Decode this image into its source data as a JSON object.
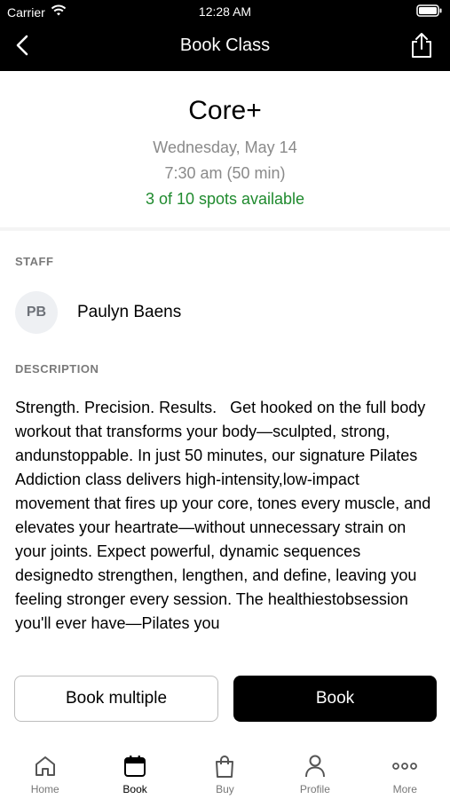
{
  "status_bar": {
    "carrier": "Carrier",
    "time": "12:28 AM"
  },
  "nav": {
    "title": "Book Class",
    "back_icon": "chevron-left-icon",
    "share_icon": "share-icon"
  },
  "class": {
    "name": "Core+",
    "date": "Wednesday, May 14",
    "time": "7:30 am (50 min)",
    "spots": "3 of 10 spots available",
    "spots_color": "#1f8a2e"
  },
  "staff": {
    "label": "STAFF",
    "initials": "PB",
    "name": "Paulyn Baens"
  },
  "description": {
    "label": "DESCRIPTION",
    "text": "Strength. Precision. Results.   Get hooked on the full body workout that transforms your body—sculpted, strong, andunstoppable. In just 50 minutes, our signature Pilates Addiction class delivers high-intensity,low-impact movement that fires up your core, tones every muscle, and elevates your heartrate—without unnecessary strain on your joints. Expect powerful, dynamic sequences designedto strengthen, lengthen, and define, leaving you feeling stronger every session. The healthiestobsession you'll ever have—Pilates you"
  },
  "actions": {
    "book_multiple": "Book multiple",
    "book": "Book"
  },
  "tabs": [
    {
      "label": "Home",
      "icon": "home-icon"
    },
    {
      "label": "Book",
      "icon": "calendar-icon",
      "active": true
    },
    {
      "label": "Buy",
      "icon": "shopping-bag-icon"
    },
    {
      "label": "Profile",
      "icon": "profile-icon"
    },
    {
      "label": "More",
      "icon": "more-dots-icon"
    }
  ]
}
